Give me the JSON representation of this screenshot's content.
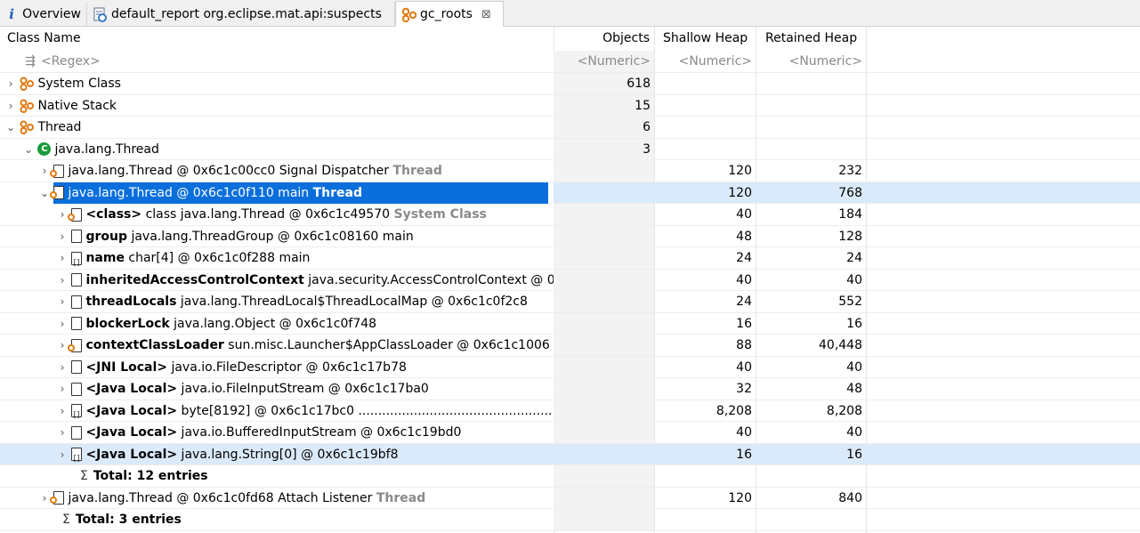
{
  "tabs": [
    {
      "label": "Overview",
      "icon": "info-icon"
    },
    {
      "label": "default_report  org.eclipse.mat.api:suspects",
      "icon": "report-icon"
    },
    {
      "label": "gc_roots",
      "icon": "gc-roots-icon",
      "close": "⊠"
    }
  ],
  "columns": {
    "class_name": "Class Name",
    "objects": "Objects",
    "shallow_heap": "Shallow Heap",
    "retained_heap": "Retained Heap"
  },
  "filter": {
    "regex": "<Regex>",
    "objects": "<Numeric>",
    "shallow": "<Numeric>",
    "retained": "<Numeric>"
  },
  "rows": [
    {
      "name": "System Class",
      "objects": "618"
    },
    {
      "name": "Native Stack",
      "objects": "15"
    },
    {
      "name": "Thread",
      "objects": "6"
    },
    {
      "name": "java.lang.Thread",
      "objects": "3"
    },
    {
      "name": "java.lang.Thread @ 0x6c1c00cc0  Signal Dispatcher ",
      "suffix": "Thread",
      "shallow": "120",
      "retained": "232"
    },
    {
      "name": "java.lang.Thread @ 0x6c1c0f110  main ",
      "suffix": "Thread",
      "shallow": "120",
      "retained": "768"
    },
    {
      "bold": "<class>",
      "name": " class java.lang.Thread @ 0x6c1c49570 ",
      "suffix": "System Class",
      "shallow": "40",
      "retained": "184"
    },
    {
      "bold": "group",
      "name": " java.lang.ThreadGroup @ 0x6c1c08160  main",
      "shallow": "48",
      "retained": "128"
    },
    {
      "bold": "name",
      "name": " char[4] @ 0x6c1c0f288  main",
      "shallow": "24",
      "retained": "24"
    },
    {
      "bold": "inheritedAccessControlContext",
      "name": " java.security.AccessControlContext @ 0",
      "shallow": "40",
      "retained": "40"
    },
    {
      "bold": "threadLocals",
      "name": " java.lang.ThreadLocal$ThreadLocalMap @ 0x6c1c0f2c8",
      "shallow": "24",
      "retained": "552"
    },
    {
      "bold": "blockerLock",
      "name": " java.lang.Object @ 0x6c1c0f748",
      "shallow": "16",
      "retained": "16"
    },
    {
      "bold": "contextClassLoader",
      "name": " sun.misc.Launcher$AppClassLoader @ 0x6c1c1006",
      "shallow": "88",
      "retained": "40,448"
    },
    {
      "bold": "<JNI Local>",
      "name": " java.io.FileDescriptor @ 0x6c1c17b78",
      "shallow": "40",
      "retained": "40"
    },
    {
      "bold": "<Java Local>",
      "name": " java.io.FileInputStream @ 0x6c1c17ba0",
      "shallow": "32",
      "retained": "48"
    },
    {
      "bold": "<Java Local>",
      "name": " byte[8192] @ 0x6c1c17bc0 ..........................................................",
      "shallow": "8,208",
      "retained": "8,208"
    },
    {
      "bold": "<Java Local>",
      "name": " java.io.BufferedInputStream @ 0x6c1c19bd0",
      "shallow": "40",
      "retained": "40"
    },
    {
      "bold": "<Java Local>",
      "name": " java.lang.String[0] @ 0x6c1c19bf8",
      "shallow": "16",
      "retained": "16"
    },
    {
      "total": "Total: 12 entries",
      "sigma": "Σ"
    },
    {
      "name": "java.lang.Thread @ 0x6c1c0fd68  Attach Listener ",
      "suffix": "Thread",
      "shallow": "120",
      "retained": "840"
    },
    {
      "total": "Total: 3 entries",
      "sigma": "Σ"
    }
  ],
  "colors": {
    "selection": "#0a6fdc",
    "hover": "#dbeafb",
    "gc_root_icon": "#e07a10",
    "class_icon": "#1a9c3c"
  }
}
